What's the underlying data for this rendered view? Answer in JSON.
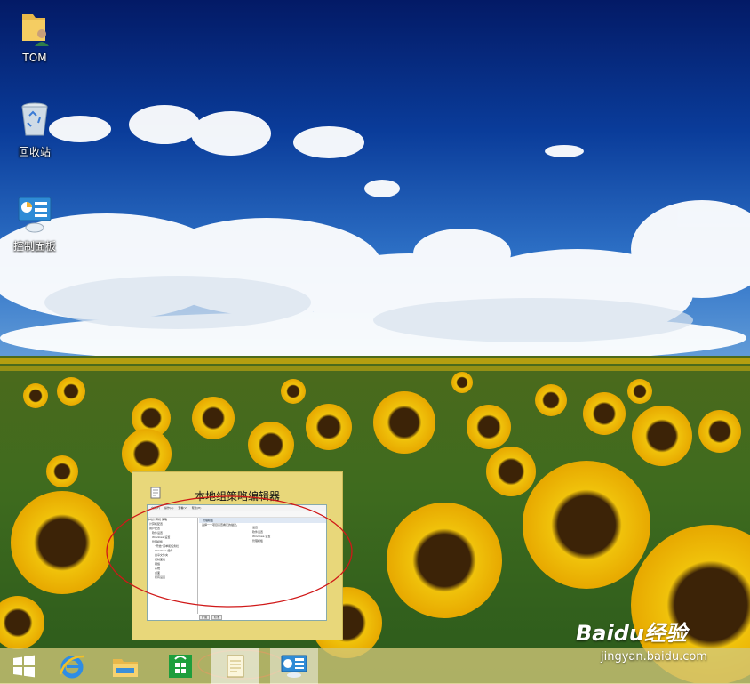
{
  "desktop": {
    "icons": [
      {
        "label": "TOM",
        "icon": "user-folder-icon"
      },
      {
        "label": "回收站",
        "icon": "recycle-bin-icon"
      },
      {
        "label": "控制面板",
        "icon": "control-panel-icon"
      }
    ]
  },
  "taskbar": {
    "items": [
      {
        "name": "start-button",
        "icon": "windows-logo-icon"
      },
      {
        "name": "internet-explorer",
        "icon": "ie-icon"
      },
      {
        "name": "file-explorer",
        "icon": "folder-icon"
      },
      {
        "name": "store",
        "icon": "store-icon"
      },
      {
        "name": "group-policy-editor",
        "icon": "document-icon",
        "active": true
      },
      {
        "name": "control-panel",
        "icon": "control-panel-icon",
        "active": true
      }
    ]
  },
  "preview": {
    "title": "本地组策略编辑器",
    "menu": [
      "文件(F)",
      "操作(A)",
      "查看(V)",
      "帮助(H)"
    ],
    "tree": [
      "本地计算机 策略",
      "计算机配置",
      "用户配置",
      "软件设置",
      "Windows 设置",
      "管理模板",
      "“开始”菜单和任务栏",
      "Windows 组件",
      "共享文件夹",
      "控制面板",
      "网络",
      "系统",
      "桌面",
      "所有设置"
    ],
    "right_header": "管理模板",
    "right_desc": "选择一个项目来查看它的描述。",
    "right_items": [
      "设置",
      "软件设置",
      "Windows 设置",
      "管理模板"
    ],
    "tabs": [
      "扩展",
      "标准"
    ]
  },
  "watermark": {
    "logo": "Baidu经验",
    "url": "jingyan.baidu.com"
  }
}
